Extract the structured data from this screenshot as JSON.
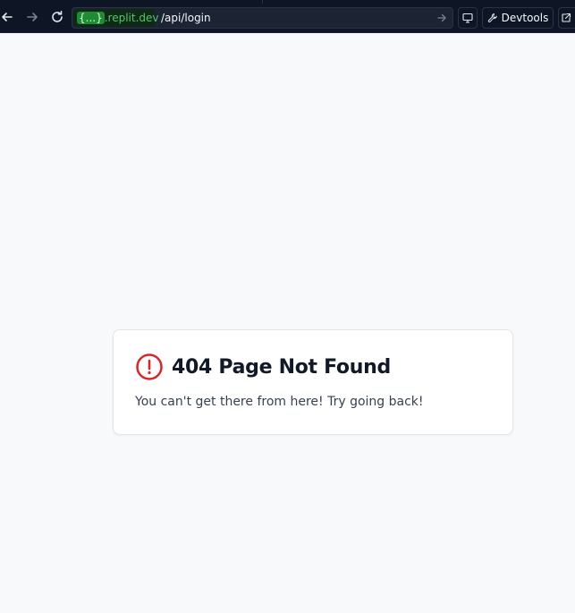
{
  "browser": {
    "url_host_token": "{...}",
    "url_host_suffix": ".replit.dev",
    "url_path": "/api/login",
    "devtools_label": "Devtools"
  },
  "error_card": {
    "title": "404 Page Not Found",
    "message": "You can't get there from here! Try going back!",
    "icon": "alert-circle-icon",
    "icon_color": "#dc2626"
  },
  "colors": {
    "toolbar_bg": "#0e1525",
    "host_green": "#58c36b",
    "page_bg": "#f8f9fb"
  }
}
